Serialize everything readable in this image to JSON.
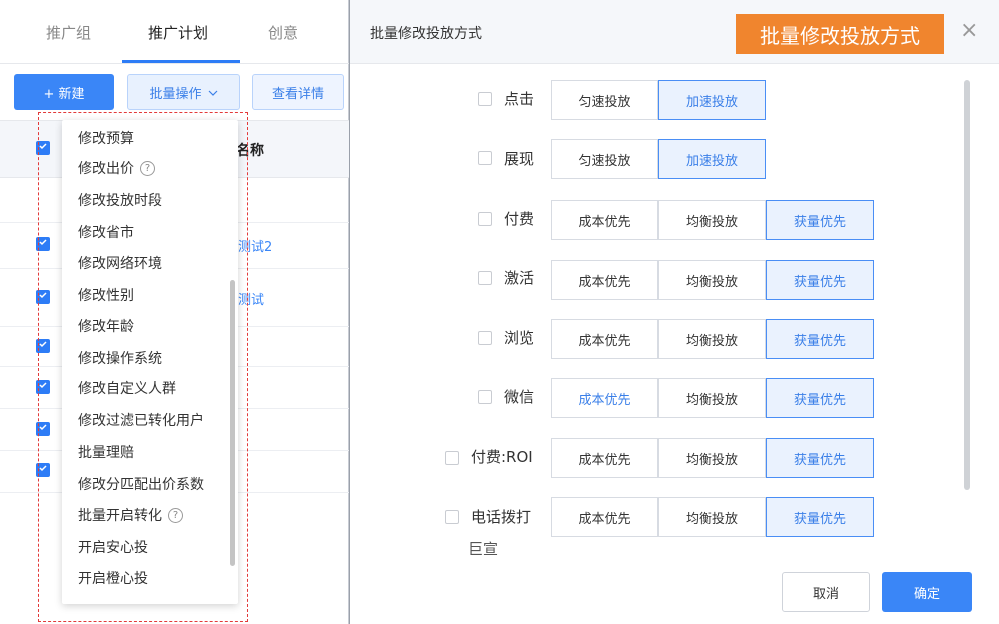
{
  "tabs": [
    "推广组",
    "推广计划",
    "创意"
  ],
  "toolbar": {
    "new_label": "+ 新建",
    "batch_label": "批量操作",
    "detail_label": "查看详情"
  },
  "table": {
    "name_header": "名称",
    "row_links": [
      "测试2",
      "测试"
    ]
  },
  "batch_menu": {
    "items": [
      "修改预算",
      "修改出价",
      "修改投放时段",
      "修改省市",
      "修改网络环境",
      "修改性别",
      "修改年龄",
      "修改操作系统",
      "修改自定义人群",
      "修改过滤已转化用户",
      "批量理赔",
      "修改分匹配出价系数",
      "批量开启转化",
      "开启安心投",
      "开启橙心投"
    ],
    "help_items": [
      "修改出价",
      "批量开启转化"
    ]
  },
  "dialog": {
    "title": "批量修改投放方式",
    "annotation": "批量修改投放方式",
    "close": "×",
    "rows": [
      {
        "label": "点击",
        "options": [
          "匀速投放",
          "加速投放"
        ],
        "selected": 1
      },
      {
        "label": "展现",
        "options": [
          "匀速投放",
          "加速投放"
        ],
        "selected": 1
      },
      {
        "label": "付费",
        "options": [
          "成本优先",
          "均衡投放",
          "获量优先"
        ],
        "selected": 2
      },
      {
        "label": "激活",
        "options": [
          "成本优先",
          "均衡投放",
          "获量优先"
        ],
        "selected": 2
      },
      {
        "label": "浏览",
        "options": [
          "成本优先",
          "均衡投放",
          "获量优先"
        ],
        "selected": 2
      },
      {
        "label": "微信",
        "options": [
          "成本优先",
          "均衡投放",
          "获量优先"
        ],
        "selected": 2
      },
      {
        "label": "付费:ROI",
        "options": [
          "成本优先",
          "均衡投放",
          "获量优先"
        ],
        "selected": 2
      },
      {
        "label": "电话拨打",
        "options": [
          "成本优先",
          "均衡投放",
          "获量优先"
        ],
        "selected": 2
      }
    ],
    "caption": "巨宣",
    "cancel_label": "取消",
    "ok_label": "确定"
  },
  "colors": {
    "primary": "#3a86f7",
    "annotation": "#f0852e",
    "dash": "#e23a3a"
  },
  "icons": {
    "help": "question-circle-icon",
    "dropdown": "chevron-down-icon",
    "check": "check-icon",
    "close": "close-icon"
  }
}
